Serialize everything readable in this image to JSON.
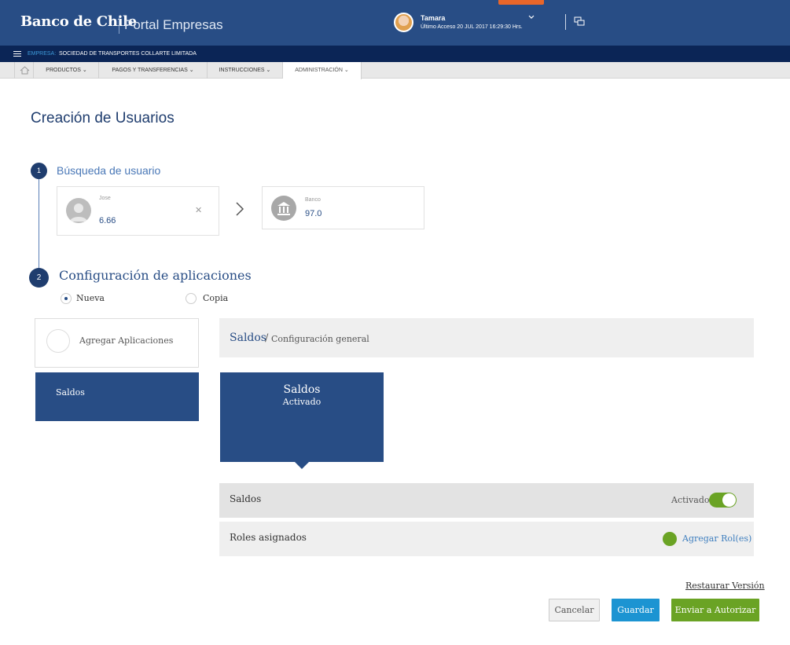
{
  "header": {
    "brand": "Banco de Chile",
    "portal": "Portal Empresas",
    "user_name": "Tamara",
    "last_access": "Último Acceso 20 JUL 2017 16:29:30 Hrs."
  },
  "company_bar": {
    "label": "EMPRESA:",
    "name": "SOCIEDAD DE TRANSPORTES COLLARTE LIMITADA"
  },
  "nav": {
    "items": [
      {
        "label": "PRODUCTOS"
      },
      {
        "label": "PAGOS Y TRANSFERENCIAS"
      },
      {
        "label": "INSTRUCCIONES"
      },
      {
        "label": "ADMINISTRACIÓN"
      }
    ]
  },
  "page": {
    "title": "Creación de Usuarios"
  },
  "step1": {
    "number": "1",
    "title": "Búsqueda de usuario",
    "user_card": {
      "small": "Jose",
      "value": "6.66"
    },
    "bank_card": {
      "small": "Banco",
      "value": "97.0"
    }
  },
  "step2": {
    "number": "2",
    "title": "Configuración de aplicaciones",
    "radio_new": "Nueva",
    "radio_copy": "Copia"
  },
  "apps": {
    "add_label": "Agregar Aplicaciones",
    "selected": "Saldos"
  },
  "config": {
    "bc_main": "Saldos",
    "bc_sep": "/",
    "bc_sub": "Configuración general",
    "tile_title": "Saldos",
    "tile_sub": "Activado",
    "row1_label": "Saldos",
    "toggle_label": "Activado",
    "row2_label": "Roles asignados",
    "add_role": "Agregar Rol(es)"
  },
  "actions": {
    "restore": "Restaurar Versión",
    "cancel": "Cancelar",
    "save": "Guardar",
    "send": "Enviar a Autorizar"
  },
  "colors": {
    "brand_blue": "#284d85",
    "dark_navy": "#0b2556",
    "accent_green": "#6aa324",
    "save_blue": "#1c94d2",
    "emergency_orange": "#e8662a"
  }
}
